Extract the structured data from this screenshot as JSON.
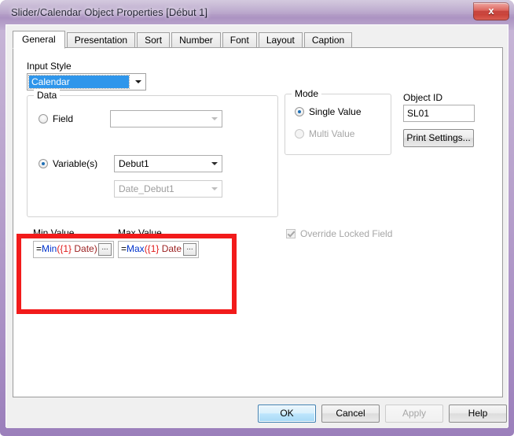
{
  "window": {
    "title": "Slider/Calendar Object Properties [Début 1]",
    "close_label": "x",
    "frame_color": "#a98fc4"
  },
  "tabs": [
    {
      "label": "General",
      "active": true
    },
    {
      "label": "Presentation",
      "active": false
    },
    {
      "label": "Sort",
      "active": false
    },
    {
      "label": "Number",
      "active": false
    },
    {
      "label": "Font",
      "active": false
    },
    {
      "label": "Layout",
      "active": false
    },
    {
      "label": "Caption",
      "active": false
    }
  ],
  "general": {
    "input_style": {
      "label": "Input Style",
      "value": "Calendar",
      "selection_color": "#2f96eb"
    },
    "data_group": {
      "title": "Data",
      "field_radio": {
        "label": "Field",
        "checked": false
      },
      "field_combo": {
        "value": "",
        "enabled": true
      },
      "variables_radio": {
        "label": "Variable(s)",
        "checked": true
      },
      "variable_combo": {
        "value": "Debut1",
        "enabled": true
      },
      "variable_combo_secondary": {
        "value": "Date_Debut1",
        "enabled": false
      }
    },
    "mode_group": {
      "title": "Mode",
      "options": [
        {
          "label": "Single Value",
          "checked": true,
          "enabled": true
        },
        {
          "label": "Multi Value",
          "checked": false,
          "enabled": false
        }
      ]
    },
    "object_id": {
      "label": "Object ID",
      "value": "SL01"
    },
    "print_settings_button": "Print Settings...",
    "min_value": {
      "label": "Min Value",
      "tokens": [
        {
          "text": "=",
          "kind": "eq"
        },
        {
          "text": "Min",
          "kind": "fn"
        },
        {
          "text": "({1}",
          "kind": "set"
        },
        {
          "text": " Date)",
          "kind": "fld"
        }
      ],
      "ellipsis": "..."
    },
    "max_value": {
      "label": "Max Value",
      "tokens": [
        {
          "text": "=",
          "kind": "eq"
        },
        {
          "text": "Max",
          "kind": "fn"
        },
        {
          "text": "({1}",
          "kind": "set"
        },
        {
          "text": " Date",
          "kind": "fld"
        }
      ],
      "ellipsis": "..."
    },
    "override_locked_field": {
      "label": "Override Locked Field",
      "checked": true,
      "enabled": false
    }
  },
  "annotation": {
    "color": "#f21b1b",
    "shape": "rectangle"
  },
  "footer": {
    "ok": "OK",
    "cancel": "Cancel",
    "apply": "Apply",
    "help": "Help"
  }
}
